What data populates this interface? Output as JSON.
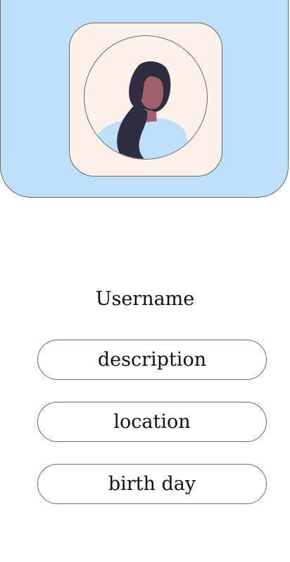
{
  "profile": {
    "username": "Username",
    "avatar_icon": "person-avatar-illustration"
  },
  "fields": [
    {
      "label": "description"
    },
    {
      "label": "location"
    },
    {
      "label": "birth day"
    }
  ],
  "colors": {
    "header_bg": "#bde0fb",
    "avatar_card_bg": "#fdf2e8",
    "border": "#6a6a6a",
    "hair": "#2f2e41",
    "skin": "#9e616a",
    "shirt": "#bde0fb"
  }
}
